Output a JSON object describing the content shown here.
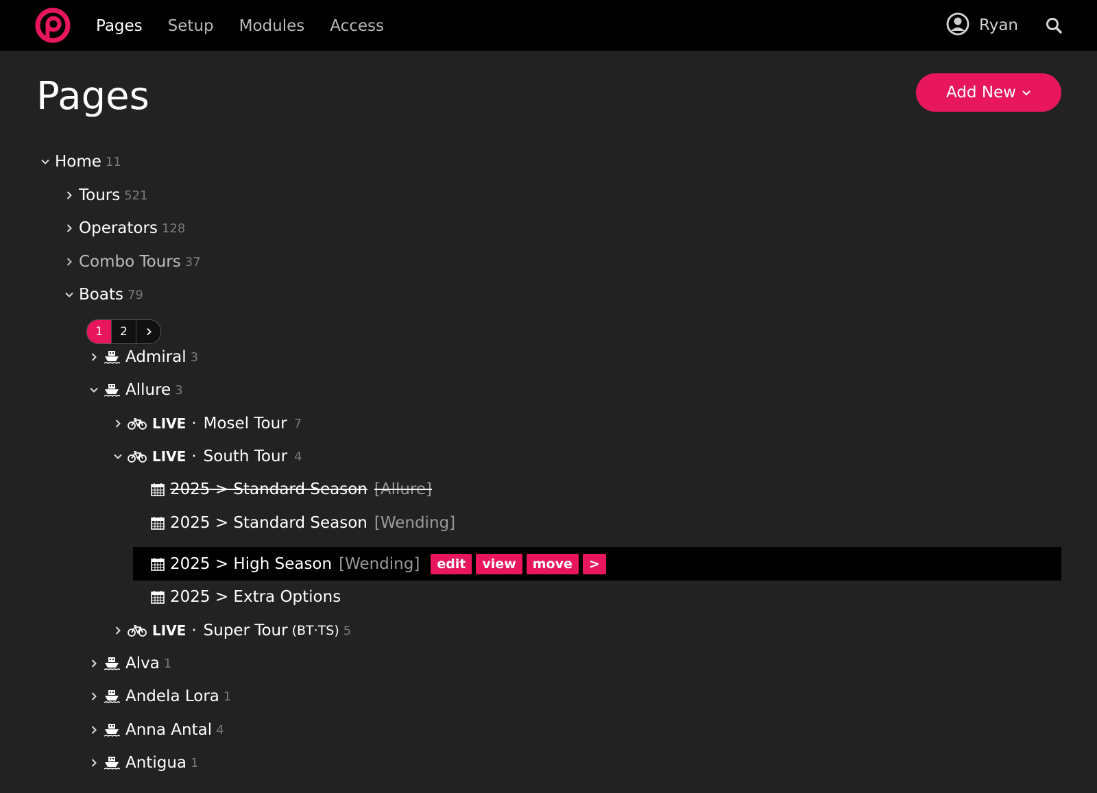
{
  "nav": {
    "items": [
      "Pages",
      "Setup",
      "Modules",
      "Access"
    ],
    "user": "Ryan"
  },
  "header": {
    "title": "Pages",
    "add_new": "Add New"
  },
  "pagination": {
    "pages": [
      "1",
      "2"
    ],
    "current": "1"
  },
  "tree": {
    "home": {
      "title": "Home",
      "count": "11"
    },
    "tours": {
      "title": "Tours",
      "count": "521"
    },
    "operators": {
      "title": "Operators",
      "count": "128"
    },
    "combo": {
      "title": "Combo Tours",
      "count": "37"
    },
    "boats": {
      "title": "Boats",
      "count": "79"
    },
    "admiral": {
      "title": "Admiral",
      "count": "3"
    },
    "allure": {
      "title": "Allure",
      "count": "3"
    },
    "mosel": {
      "status": "LIVE",
      "sep": "·",
      "title": "Mosel Tour",
      "count": "7"
    },
    "south": {
      "status": "LIVE",
      "sep": "·",
      "title": "South Tour",
      "count": "4"
    },
    "season1": {
      "title": "2025 > Standard Season",
      "tag": "[Allure]"
    },
    "season2": {
      "title": "2025 > Standard Season",
      "tag": "[Wending]"
    },
    "season3": {
      "title": "2025 > High Season",
      "tag": "[Wending]",
      "actions": [
        "edit",
        "view",
        "move",
        ">"
      ]
    },
    "season4": {
      "title": "2025 > Extra Options"
    },
    "super": {
      "status": "LIVE",
      "sep": "·",
      "title": "Super Tour",
      "sub": "(BT·TS)",
      "count": "5"
    },
    "alva": {
      "title": "Alva",
      "count": "1"
    },
    "andela": {
      "title": "Andela Lora",
      "count": "1"
    },
    "anna": {
      "title": "Anna Antal",
      "count": "4"
    },
    "antigua": {
      "title": "Antigua",
      "count": "1"
    }
  },
  "icons": {
    "accent": "#e8175d",
    "boat": "ship-icon",
    "bike": "bicycle-icon",
    "calendar": "calendar-icon"
  }
}
